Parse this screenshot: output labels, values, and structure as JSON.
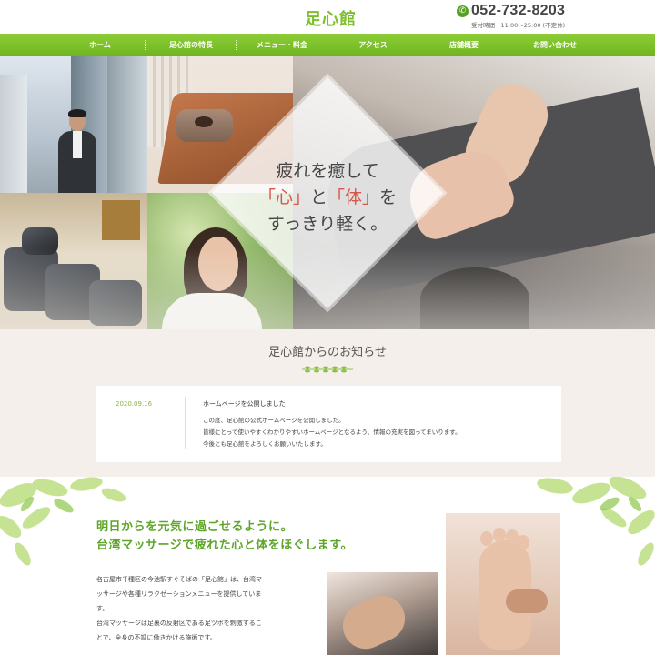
{
  "header": {
    "logo": "足心館",
    "tel": "052-732-8203",
    "hours": "受付時間　11:00～25:00 (不定休)"
  },
  "nav": {
    "items": [
      "ホーム",
      "足心館の特長",
      "メニュー・料金",
      "アクセス",
      "店舗概要",
      "お問い合わせ"
    ]
  },
  "hero": {
    "line1": "疲れを癒して",
    "word_kokoro": "「心」",
    "particle_to": "と",
    "word_karada": "「体」",
    "particle_wo": "を",
    "line3": "すっきり軽く。",
    "accent_color": "#d8564a"
  },
  "news": {
    "title": "足心館からのお知らせ",
    "date": "2020.09.16",
    "heading": "ホームページを公開しました",
    "lines": [
      "この度、足心館の公式ホームページを公開しました。",
      "皆様にとって使いやすくわかりやすいホームページとなるよう、情報の充実を図ってまいります。",
      "今後とも足心館をよろしくお願いいたします。"
    ]
  },
  "intro": {
    "title_lines": [
      "明日からを元気に過ごせるように。",
      "台湾マッサージで疲れた心と体をほぐします。"
    ],
    "text_lines": [
      "名古屋市千種区の今池駅すぐそばの「足心館」は、台湾マ",
      "ッサージや各種リラクゼーションメニューを提供していま",
      "す。",
      "台湾マッサージは足裏の反射区である足ツボを刺激するこ",
      "とで、全身の不調に働きかける施術です。"
    ]
  },
  "colors": {
    "brand_green": "#7bbf2a",
    "nav_green": "#6fb51f",
    "news_bg": "#f4efea"
  },
  "icons": {
    "phone": "phone-icon"
  }
}
